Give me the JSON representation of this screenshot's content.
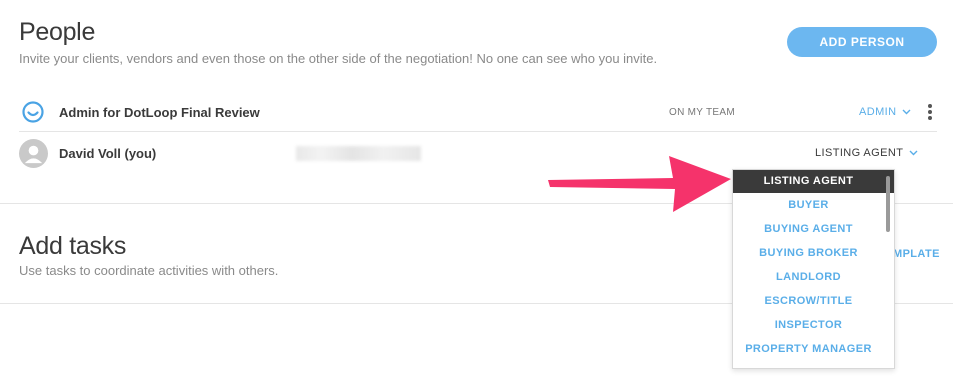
{
  "people": {
    "title": "People",
    "subtitle": "Invite your clients, vendors and even those on the other side of the negotiation! No one can see who you invite.",
    "add_button": "ADD PERSON",
    "rows": [
      {
        "name": "Admin for DotLoop Final Review",
        "team_label": "ON MY TEAM",
        "role": "ADMIN"
      },
      {
        "name": "David Voll (you)",
        "role": "LISTING AGENT"
      }
    ]
  },
  "tasks": {
    "title": "Add tasks",
    "subtitle": "Use tasks to coordinate activities with others.",
    "template_partial": "MPLATE"
  },
  "role_dropdown": {
    "selected": "LISTING AGENT",
    "options": [
      "LISTING AGENT",
      "BUYER",
      "BUYING AGENT",
      "BUYING BROKER",
      "LANDLORD",
      "ESCROW/TITLE",
      "INSPECTOR",
      "PROPERTY MANAGER"
    ]
  },
  "colors": {
    "accent": "#6cb7f0",
    "link": "#5aaee8",
    "arrow": "#f5336b",
    "selected_bg": "#3a3a3a"
  }
}
